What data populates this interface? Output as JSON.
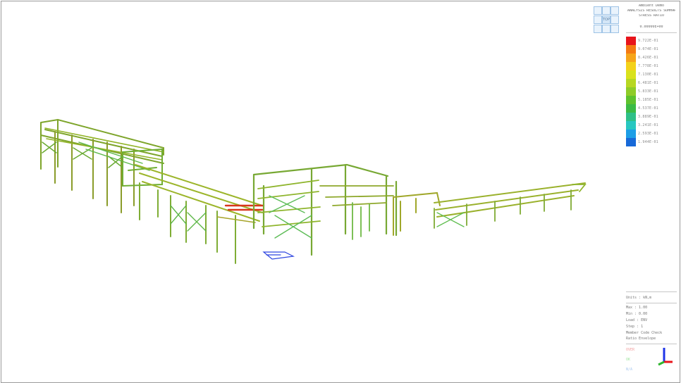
{
  "viewer": {
    "nav_cube": {
      "center_label": "TOP"
    }
  },
  "legend": {
    "header": [
      "Ambient Demo",
      "ANALYSIS RESULTS SUMMARY",
      "STRESS RATIO",
      "0.00000E+00"
    ],
    "items": [
      {
        "color": "#e8141b",
        "label": "9.722E-01"
      },
      {
        "color": "#f47a12",
        "label": "9.074E-01"
      },
      {
        "color": "#f6a51a",
        "label": "8.426E-01"
      },
      {
        "color": "#f4d21a",
        "label": "7.778E-01"
      },
      {
        "color": "#d9e21c",
        "label": "7.130E-01"
      },
      {
        "color": "#b7d722",
        "label": "6.481E-01"
      },
      {
        "color": "#8fcc28",
        "label": "5.833E-01"
      },
      {
        "color": "#5ec22e",
        "label": "5.185E-01"
      },
      {
        "color": "#3bbb45",
        "label": "4.537E-01"
      },
      {
        "color": "#2fc088",
        "label": "3.889E-01"
      },
      {
        "color": "#28c7c0",
        "label": "3.241E-01"
      },
      {
        "color": "#1d9ee6",
        "label": "2.593E-01"
      },
      {
        "color": "#1769d8",
        "label": "1.944E-01"
      }
    ]
  },
  "info": {
    "lines": [
      "Units : kN,m",
      "Max : 1.00",
      "Min : 0.00",
      "Load : ENV",
      "Step : 1",
      "Member Code Check",
      "Ratio Envelope"
    ],
    "codes": [
      {
        "color": "#f2a0a0",
        "label": "OVER"
      },
      {
        "color": "#9fe59f",
        "label": "OK"
      },
      {
        "color": "#a9c8ef",
        "label": "N/A"
      }
    ]
  },
  "axis_colors": {
    "x": "#e8141b",
    "y": "#2fb52f",
    "z": "#1f35e8"
  }
}
